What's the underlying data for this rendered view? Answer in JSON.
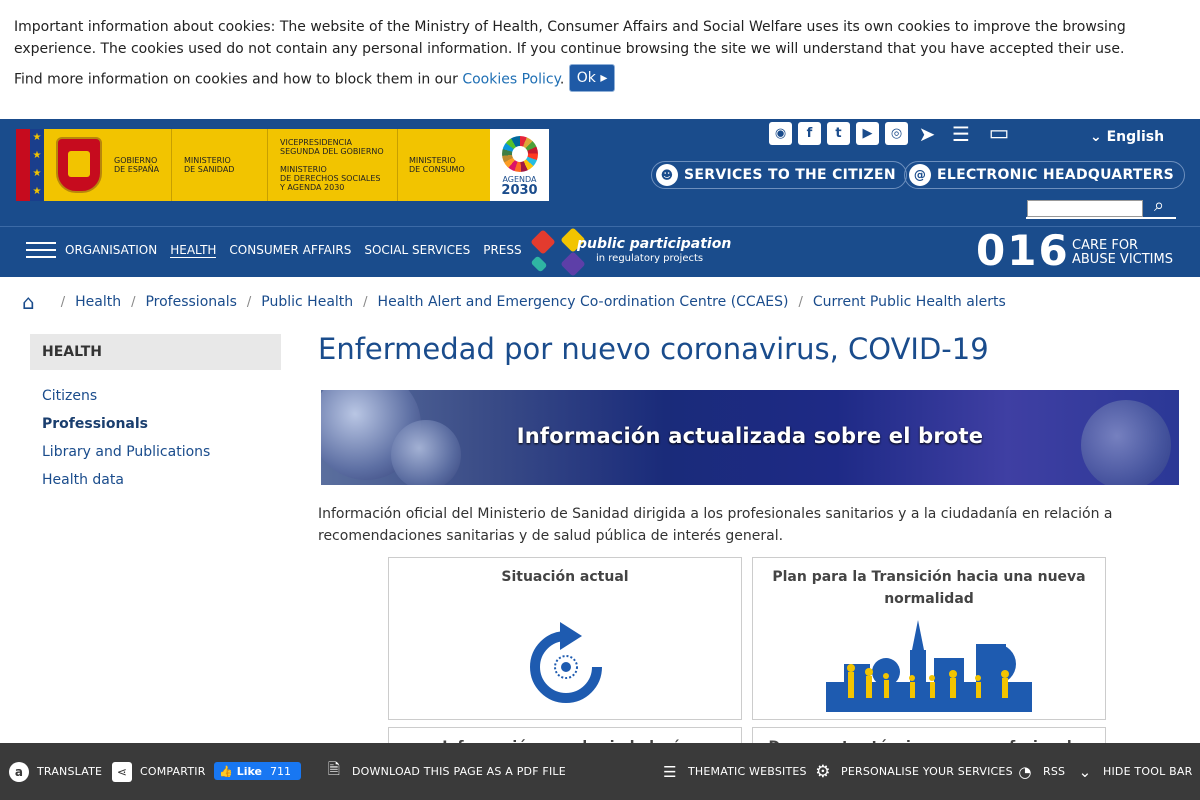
{
  "cookie": {
    "text1": "Important information about cookies: The website of the Ministry of Health, Consumer Affairs and Social Welfare uses its own cookies to improve the browsing experience. The cookies used do not contain any personal information. If you continue browsing the site we will understand that you have accepted their use.",
    "text2_prefix": "Find more information on cookies and how to block them in our ",
    "policy_link": "Cookies Policy",
    "text2_suffix": ". ",
    "ok_label": "Ok ▸"
  },
  "logo": {
    "gov": "GOBIERNO\nDE ESPAÑA",
    "sanidad": "MINISTERIO\nDE SANIDAD",
    "vice": "VICEPRESIDENCIA\nSEGUNDA DEL GOBIERNO\n\nMINISTERIO\nDE DERECHOS SOCIALES\nY AGENDA 2030",
    "consumo": "MINISTERIO\nDE CONSUMO",
    "agenda_label": "AGENDA",
    "agenda_year": "2030"
  },
  "header": {
    "language": "English",
    "services_label": "SERVICES TO THE CITIZEN",
    "electronic_label": "ELECTRONIC HEADQUARTERS",
    "social_icons": [
      "rss-icon",
      "facebook-icon",
      "twitter-icon",
      "youtube-icon",
      "instagram-icon",
      "telegram-icon",
      "list-icon",
      "laptop-icon"
    ]
  },
  "nav": {
    "items": [
      "ORGANISATION",
      "HEALTH",
      "CONSUMER AFFAIRS",
      "SOCIAL SERVICES",
      "PRESS"
    ],
    "pp_title": "public participation",
    "pp_sub": "in regulatory projects",
    "phone": "016",
    "phone_text1": "CARE FOR",
    "phone_text2": "ABUSE VICTIMS"
  },
  "breadcrumb": [
    "Health",
    "Professionals",
    "Public Health",
    "Health Alert and Emergency Co-ordination Centre (CCAES)",
    "Current Public Health alerts"
  ],
  "sidebar": {
    "heading": "HEALTH",
    "items": [
      {
        "label": "Citizens"
      },
      {
        "label": "Professionals"
      },
      {
        "label": "Library and Publications"
      },
      {
        "label": "Health data"
      }
    ]
  },
  "main": {
    "title": "Enfermedad por nuevo coronavirus, COVID-19",
    "banner_text": "Información actualizada sobre el brote",
    "description": "Información oficial del Ministerio de Sanidad dirigida a los profesionales sanitarios y a la ciudadanía en relación a recomendaciones sanitarias y de salud pública de interés general.",
    "cards": [
      {
        "title": "Situación actual"
      },
      {
        "title": "Plan para la Transición hacia una nueva normalidad"
      },
      {
        "title": "Información para la ciudadanía"
      },
      {
        "title": "Documentos técnicos para profesionales"
      }
    ]
  },
  "toolbar": {
    "translate": "TRANSLATE",
    "share": "COMPARTIR",
    "like": "Like",
    "like_count": "711",
    "pdf": "DOWNLOAD THIS PAGE AS A PDF FILE",
    "thematic": "THEMATIC WEBSITES",
    "personalise": "PERSONALISE YOUR SERVICES",
    "rss": "RSS",
    "hide": "HIDE TOOL BAR"
  },
  "colors": {
    "header": "#1a4c8c",
    "link": "#1f6fb4",
    "toolbar": "#3a3a3a",
    "logo_yellow": "#f2c400"
  }
}
